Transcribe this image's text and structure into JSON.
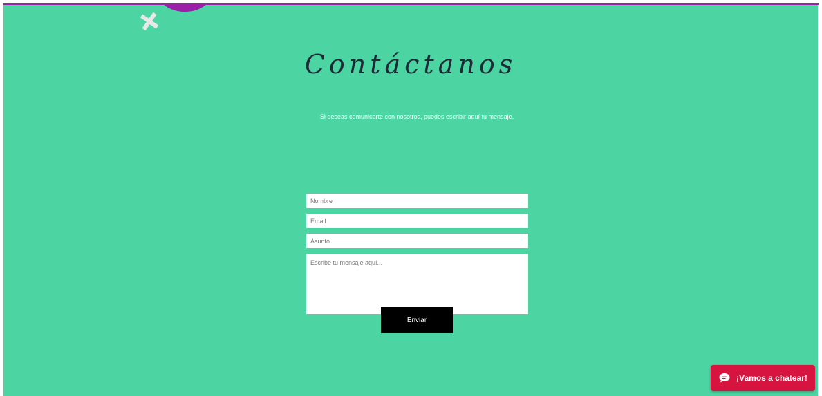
{
  "contact": {
    "title": "Contáctanos",
    "subtitle": "Si deseas comunicarte con nosotros, puedes escribir aquí tu mensaje."
  },
  "form": {
    "name_placeholder": "Nombre",
    "email_placeholder": "Email",
    "subject_placeholder": "Asunto",
    "message_placeholder": "Escribe tu mensaje aquí...",
    "submit_label": "Enviar"
  },
  "chat": {
    "label": "¡Vamos a chatear!",
    "icon": "chat-bubble-icon"
  },
  "colors": {
    "background": "#4cd4a2",
    "accent_purple": "#9b1fa8",
    "chat_red": "#d6143f",
    "title_color": "#1d2a36",
    "button_black": "#000000"
  }
}
